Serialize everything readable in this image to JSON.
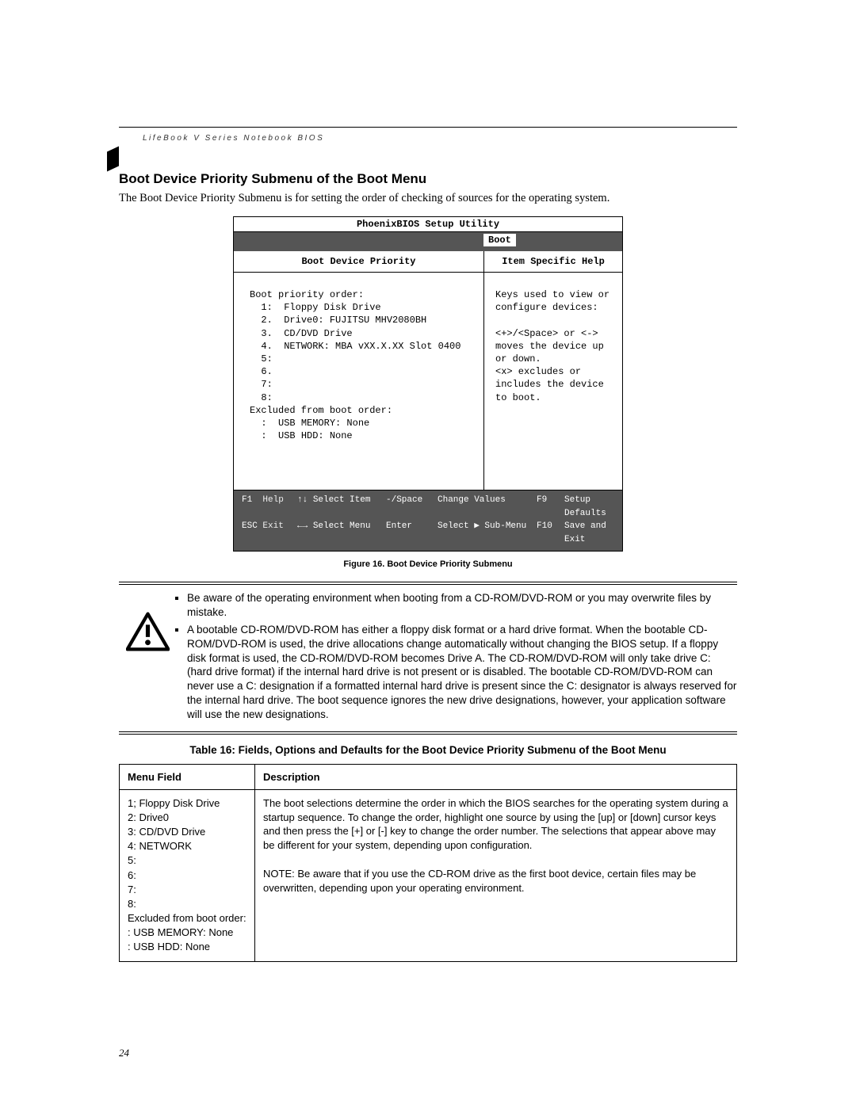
{
  "header": "LifeBook V Series Notebook BIOS",
  "section_title": "Boot Device Priority Submenu of the Boot Menu",
  "intro": "The Boot Device Priority Submenu is for setting the order of checking of sources for the operating system.",
  "bios": {
    "utility_title": "PhoenixBIOS Setup Utility",
    "active_tab": "Boot",
    "left_title": "Boot Device Priority",
    "right_title": "Item Specific Help",
    "priority_label": "Boot priority order:",
    "items": [
      "1:  Floppy Disk Drive",
      "2.  Drive0: FUJITSU MHV2080BH",
      "3.  CD/DVD Drive",
      "4.  NETWORK: MBA vXX.X.XX Slot 0400",
      "5:",
      "6.",
      "7:",
      "8:"
    ],
    "excluded_label": "Excluded from boot order:",
    "excluded": [
      ":  USB MEMORY: None",
      ":  USB HDD: None"
    ],
    "help_lines": [
      "Keys used to view or",
      "configure devices:",
      "",
      "<+>/<Space> or <->",
      "moves the device up or down.",
      "<x> excludes or includes the device to boot."
    ],
    "footer": {
      "r1": {
        "k1": "F1",
        "l1": "Help",
        "k2": "↑↓",
        "l2": "Select Item",
        "k3": "-/Space",
        "l3": "Change Values",
        "k4": "F9",
        "l4": "Setup Defaults"
      },
      "r2": {
        "k1": "ESC",
        "l1": "Exit",
        "k2": "←→",
        "l2": "Select Menu",
        "k3": "Enter",
        "l3": "Select ▶ Sub-Menu",
        "k4": "F10",
        "l4": "Save and Exit"
      }
    }
  },
  "figure_caption": "Figure 16.  Boot Device Priority Submenu",
  "warn": {
    "b1": "Be aware of the operating environment when booting from a CD-ROM/DVD-ROM or you may overwrite files by mistake.",
    "b2": "A bootable CD-ROM/DVD-ROM has either a floppy disk format or a hard drive format. When the bootable CD-ROM/DVD-ROM is used, the drive allocations change automatically without changing the BIOS setup. If a floppy disk format is used, the CD-ROM/DVD-ROM becomes Drive A. The CD-ROM/DVD-ROM will only take drive C: (hard drive format) if the internal hard drive is not present or is disabled. The bootable CD-ROM/DVD-ROM can never use a C: designation if a formatted internal hard drive is present since the C: designator is always reserved for the internal hard drive. The boot sequence ignores the new drive designations, however, your application software will use the new designations."
  },
  "table_title": "Table 16: Fields, Options and Defaults for the Boot Device Priority Submenu of the Boot Menu",
  "table": {
    "h1": "Menu Field",
    "h2": "Description",
    "menu_field": "1; Floppy Disk Drive\n2: Drive0\n3: CD/DVD Drive\n4: NETWORK\n5:\n6:\n7:\n8:\nExcluded from boot order:\n:   USB MEMORY: None\n:   USB HDD: None",
    "description": "The boot selections determine the order in which the BIOS searches for the operating system during a startup sequence. To change the order, highlight one source by using the [up] or [down] cursor keys and then press the [+] or [-] key to change the order number. The selections that appear above may be different for your system, depending upon configuration.\n\nNOTE: Be aware that if you use the CD-ROM drive as the first boot device, certain files may be overwritten, depending upon your operating environment."
  },
  "page_number": "24"
}
